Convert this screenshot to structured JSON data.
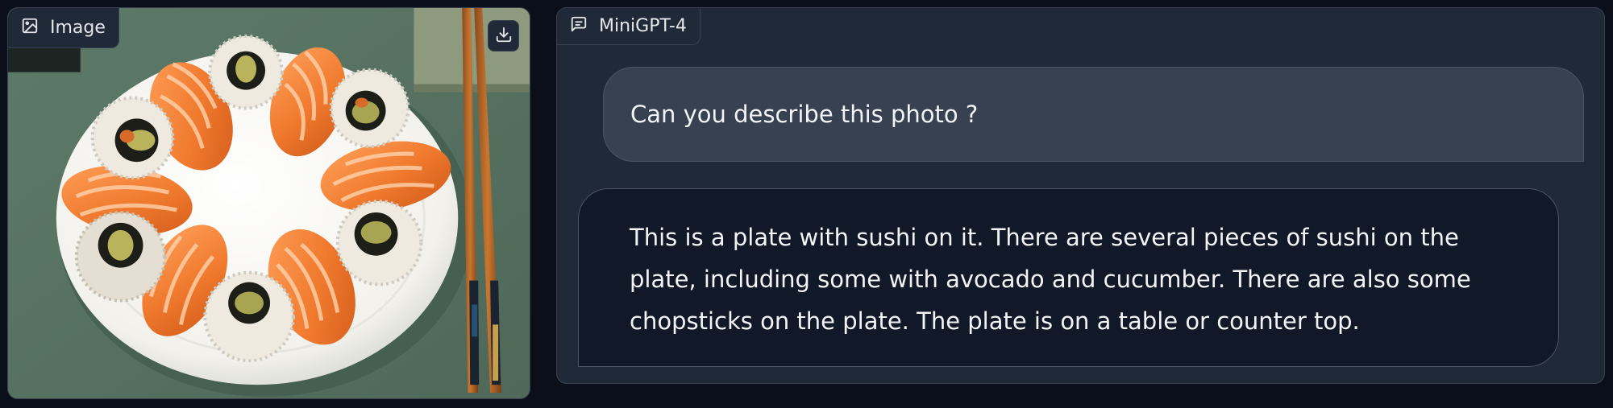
{
  "image_panel": {
    "label": "Image",
    "icon": "image-icon",
    "download_icon": "download-icon",
    "photo_subject": "sushi-plate-photo"
  },
  "chat_panel": {
    "label": "MiniGPT-4",
    "icon": "chat-icon",
    "messages": [
      {
        "role": "user",
        "text": "Can you describe this photo ?"
      },
      {
        "role": "bot",
        "text": "This is a plate with sushi on it. There are several pieces of sushi on the plate, including some with avocado and cucumber. There are also some chopsticks on the plate. The plate is on a table or counter top."
      }
    ]
  },
  "colors": {
    "page_bg": "#0b0f19",
    "panel_bg": "#1f2937",
    "user_bubble": "#374151",
    "bot_bubble": "#111827",
    "salmon": "#f07a2e",
    "rice": "#eeeae0",
    "table": "#5c7766"
  }
}
